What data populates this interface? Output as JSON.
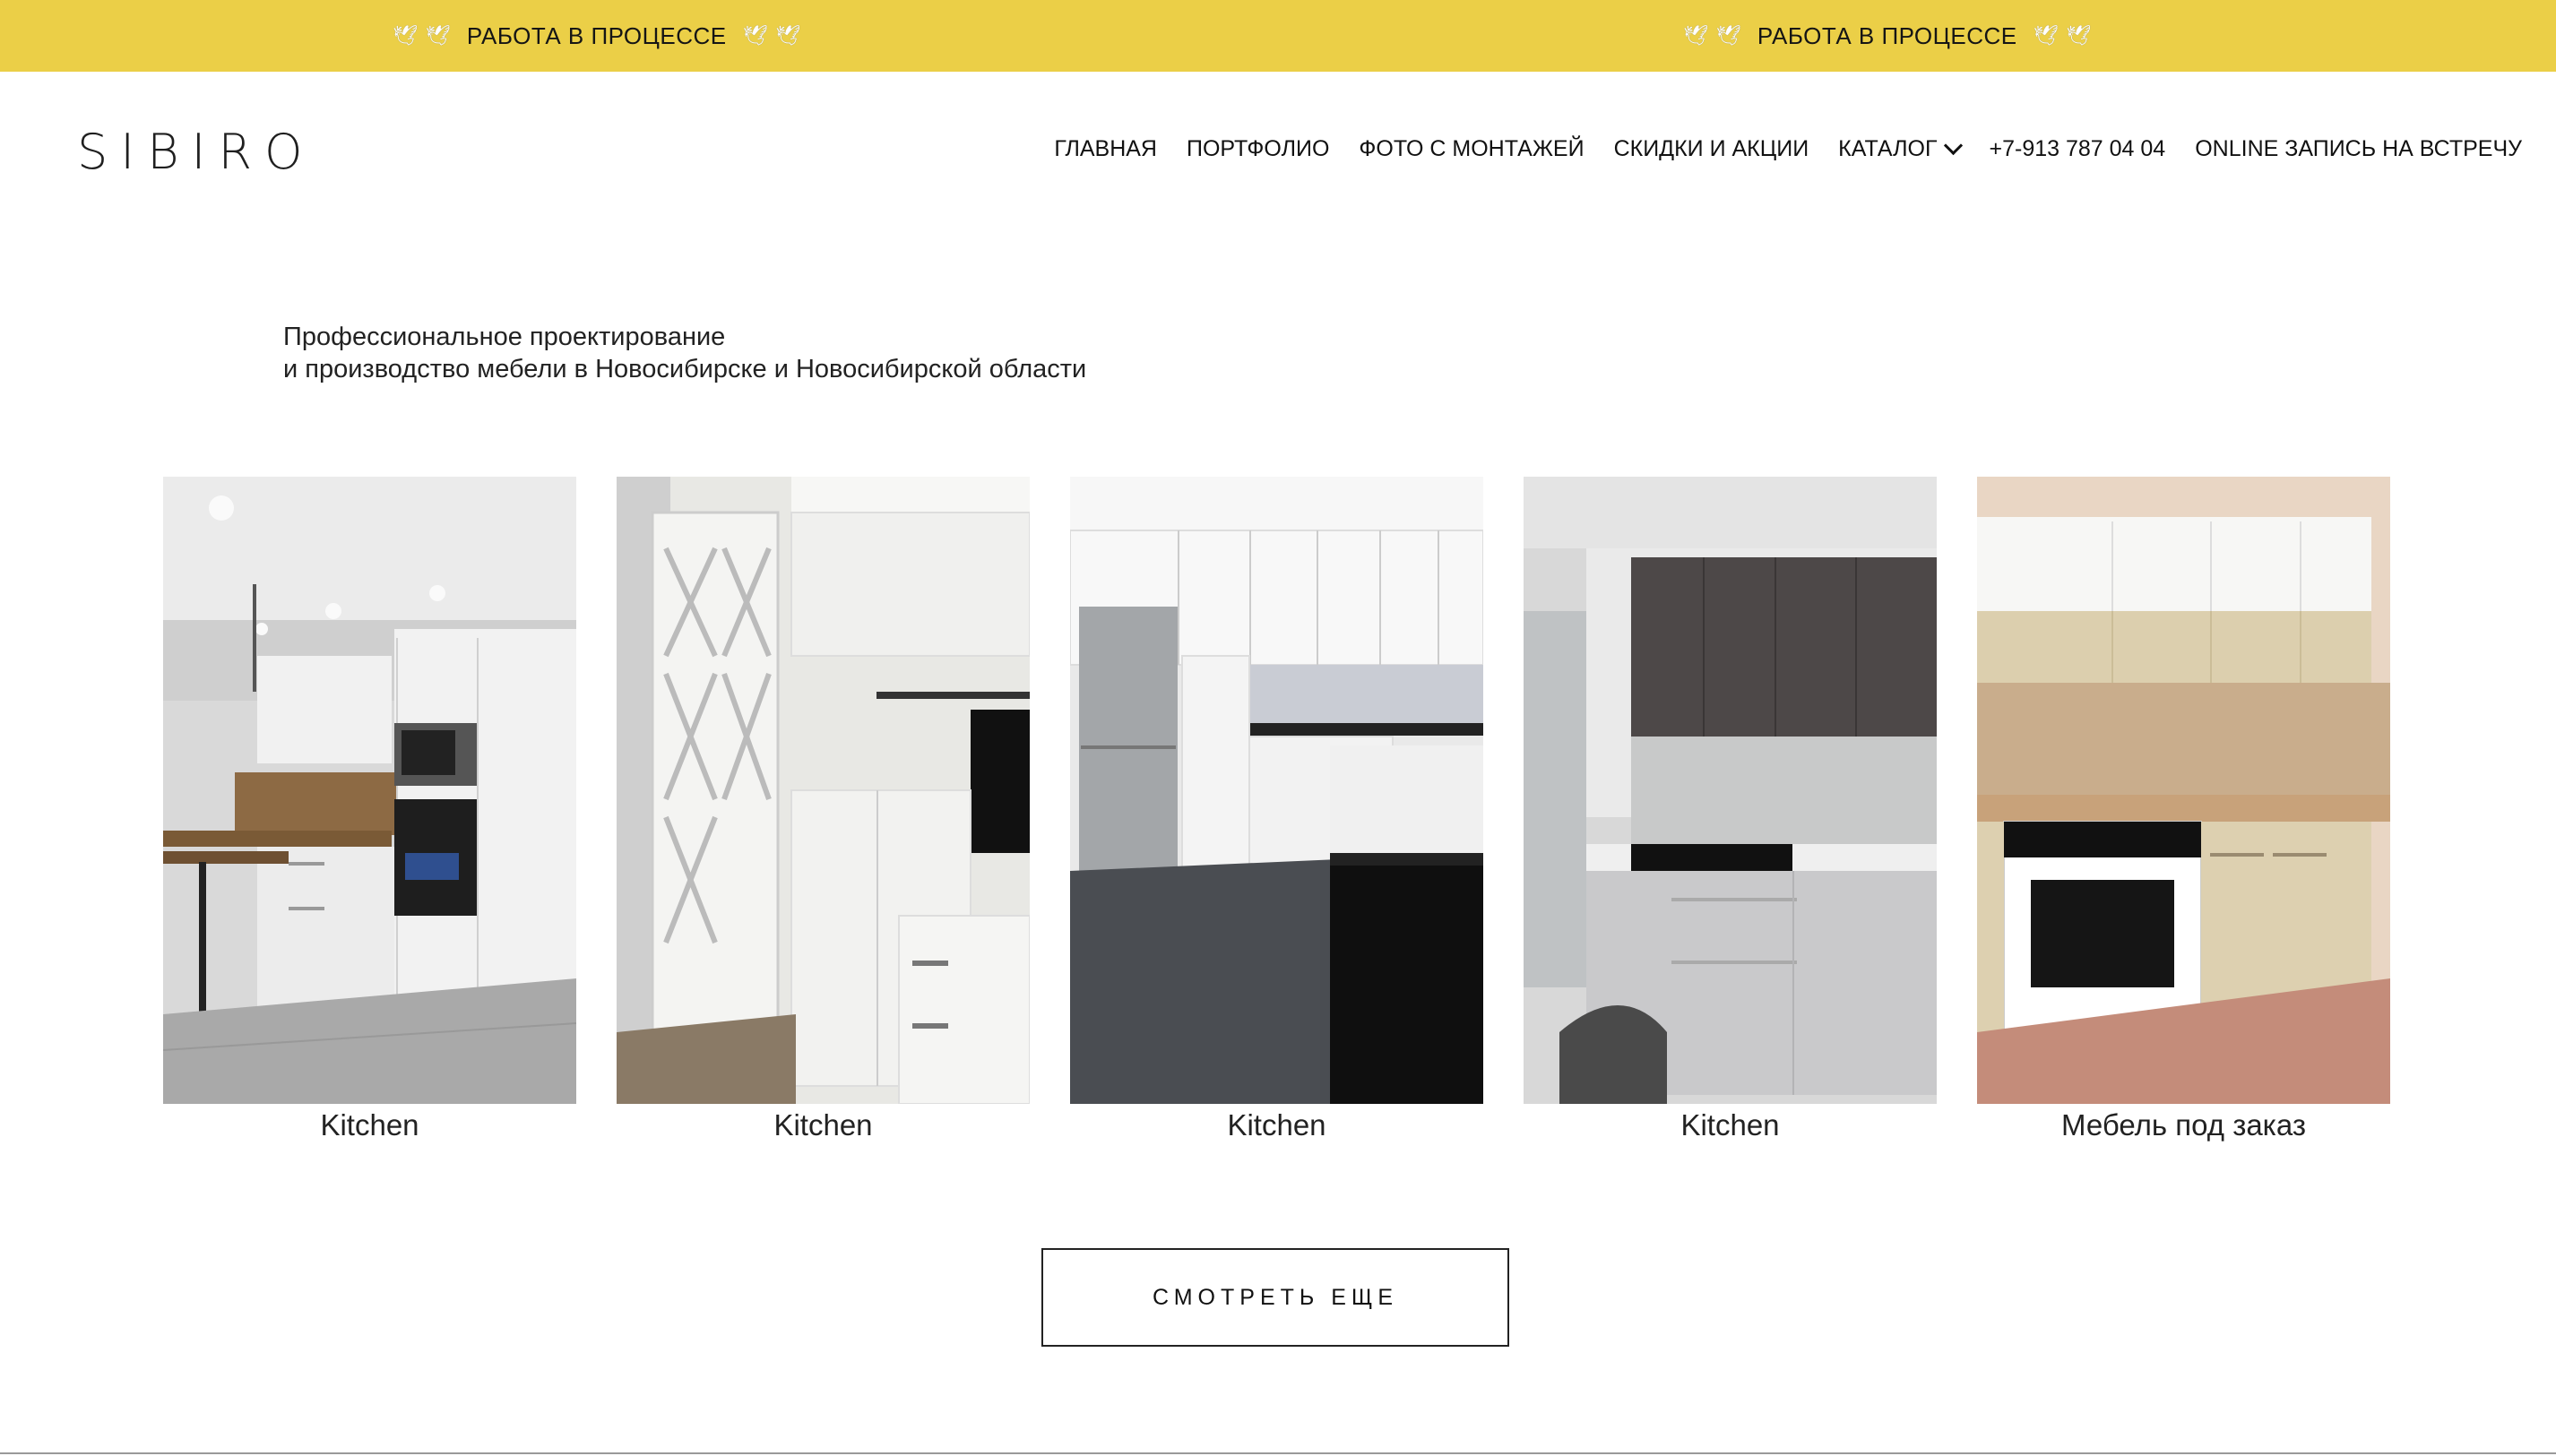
{
  "banner": {
    "text": "РАБОТА В ПРОЦЕССЕ",
    "dove_icon": "dove-icon",
    "color": "#ebcf47"
  },
  "logo": "SIBIRO",
  "nav": {
    "home": "ГЛАВНАЯ",
    "portfolio": "ПОРТФОЛИО",
    "install_photos": "ФОТО С МОНТАЖЕЙ",
    "discounts": "СКИДКИ И АКЦИИ",
    "catalog": "КАТАЛОГ",
    "phone": "+7-913 787 04 04",
    "online_booking": "ONLINE ЗАПИСЬ НА ВСТРЕЧУ"
  },
  "tagline": {
    "line1": "Профессиональное проектирование",
    "line2": "и производство мебели в Новосибирске и Новосибирской области"
  },
  "gallery": [
    {
      "caption": "Kitchen"
    },
    {
      "caption": "Kitchen"
    },
    {
      "caption": "Kitchen"
    },
    {
      "caption": "Kitchen"
    },
    {
      "caption": "Мебель под заказ"
    }
  ],
  "more_button": "СМОТРЕТЬ ЕЩЕ"
}
